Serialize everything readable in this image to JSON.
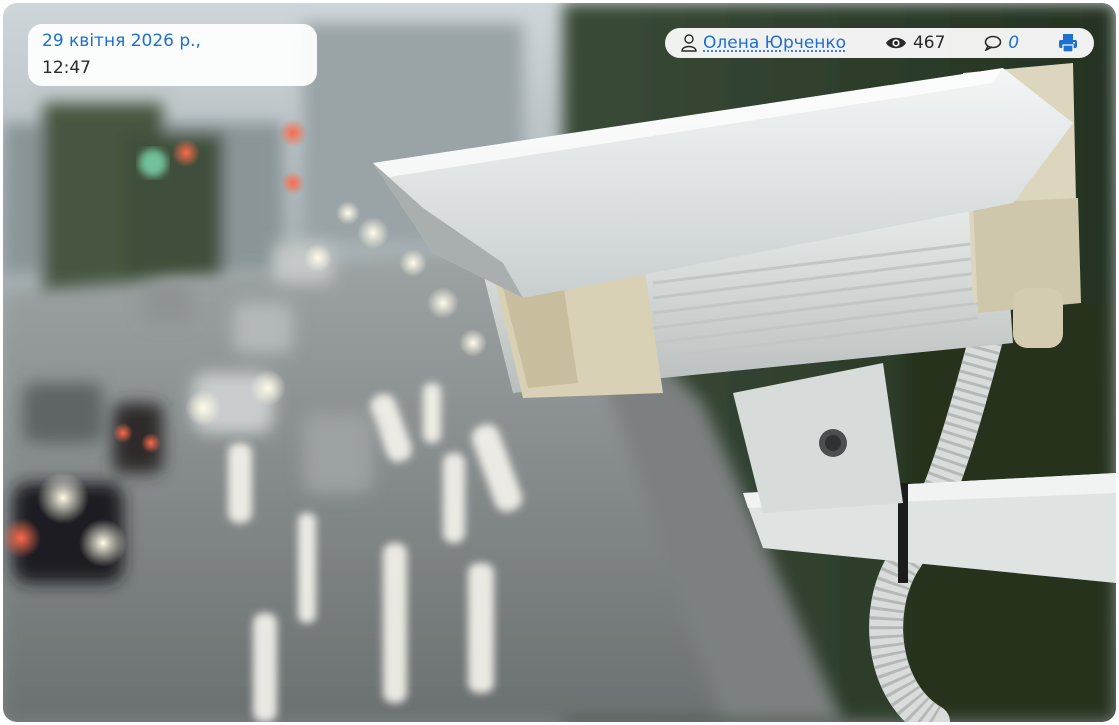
{
  "article": {
    "date": "29 квітня 2026 р.,",
    "time": "12:47"
  },
  "meta": {
    "author_icon": "user-outline-icon",
    "author": "Олена Юрченко",
    "views_icon": "eye-icon",
    "views": "467",
    "comments_icon": "comment-bubble-icon",
    "comments": "0",
    "print_icon": "printer-icon"
  },
  "photo": {
    "subject_icon": "surveillance-camera-over-highway"
  },
  "colors": {
    "link": "#1d6fd0",
    "text": "#2a2a2a",
    "panel_bg": "#ffffff"
  }
}
